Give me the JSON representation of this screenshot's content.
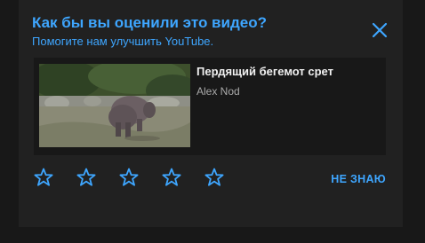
{
  "dialog": {
    "title": "Как бы вы оценили это видео?",
    "subtitle": "Помогите нам улучшить YouTube.",
    "close_icon": "close-icon"
  },
  "video": {
    "title": "Пердящий бегемот срет",
    "channel": "Alex Nod"
  },
  "rating": {
    "star_icon": "star-outline-icon",
    "max": 5,
    "value": 0,
    "unknown_label": "НЕ ЗНАЮ"
  },
  "colors": {
    "accent": "#3ea6ff",
    "panel": "#212121",
    "card": "#181818",
    "text": "#f1f1f1",
    "secondary_text": "#aaaaaa"
  }
}
